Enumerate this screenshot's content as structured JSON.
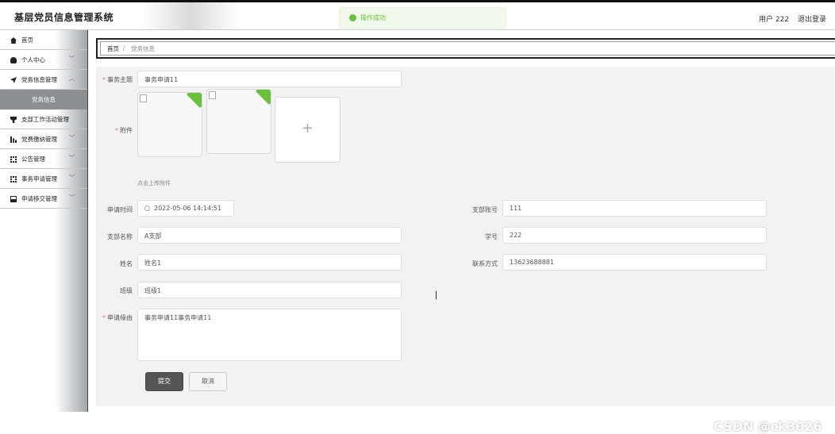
{
  "header": {
    "app_title": "基层党员信息管理系统",
    "toast": "操作成功",
    "user": "用户 222",
    "logout": "退出登录"
  },
  "sidebar": {
    "items": [
      {
        "label": "首页",
        "icon": "home-icon"
      },
      {
        "label": "个人中心",
        "icon": "user-icon"
      },
      {
        "label": "党务信息管理",
        "icon": "send-icon"
      },
      {
        "label": "党务信息",
        "icon": ""
      },
      {
        "label": "支部工作活动管理",
        "icon": "trophy-icon"
      },
      {
        "label": "党费缴纳管理",
        "icon": "chart-icon"
      },
      {
        "label": "公告管理",
        "icon": "grid-icon"
      },
      {
        "label": "事务申请管理",
        "icon": "grid-icon"
      },
      {
        "label": "申请移交管理",
        "icon": "picture-icon"
      }
    ]
  },
  "breadcrumb": {
    "home": "首页",
    "separator": "/",
    "current": "党务信息"
  },
  "form": {
    "subject_label": "事务主题",
    "subject_value": "事务申请11",
    "attachment_label": "附件",
    "attachment_hint": "点击上传附件",
    "apply_time_label": "申请时间",
    "apply_time_value": "2022-05-06 14:14:51",
    "branch_account_label": "支部账号",
    "branch_account_value": "111",
    "branch_name_label": "支部名称",
    "branch_name_value": "A支部",
    "student_no_label": "学号",
    "student_no_value": "222",
    "name_label": "姓名",
    "name_value": "姓名1",
    "contact_label": "联系方式",
    "contact_value": "13623688881",
    "class_label": "班级",
    "class_value": "班级1",
    "reason_label": "申请缘由",
    "reason_value": "事务申请11事务申请11",
    "submit": "提交",
    "cancel": "取消"
  },
  "watermark": "CSDN @ck3026",
  "colors": {
    "success": "#67c23a",
    "required": "#f56c6c",
    "primary_button": "#555555"
  }
}
